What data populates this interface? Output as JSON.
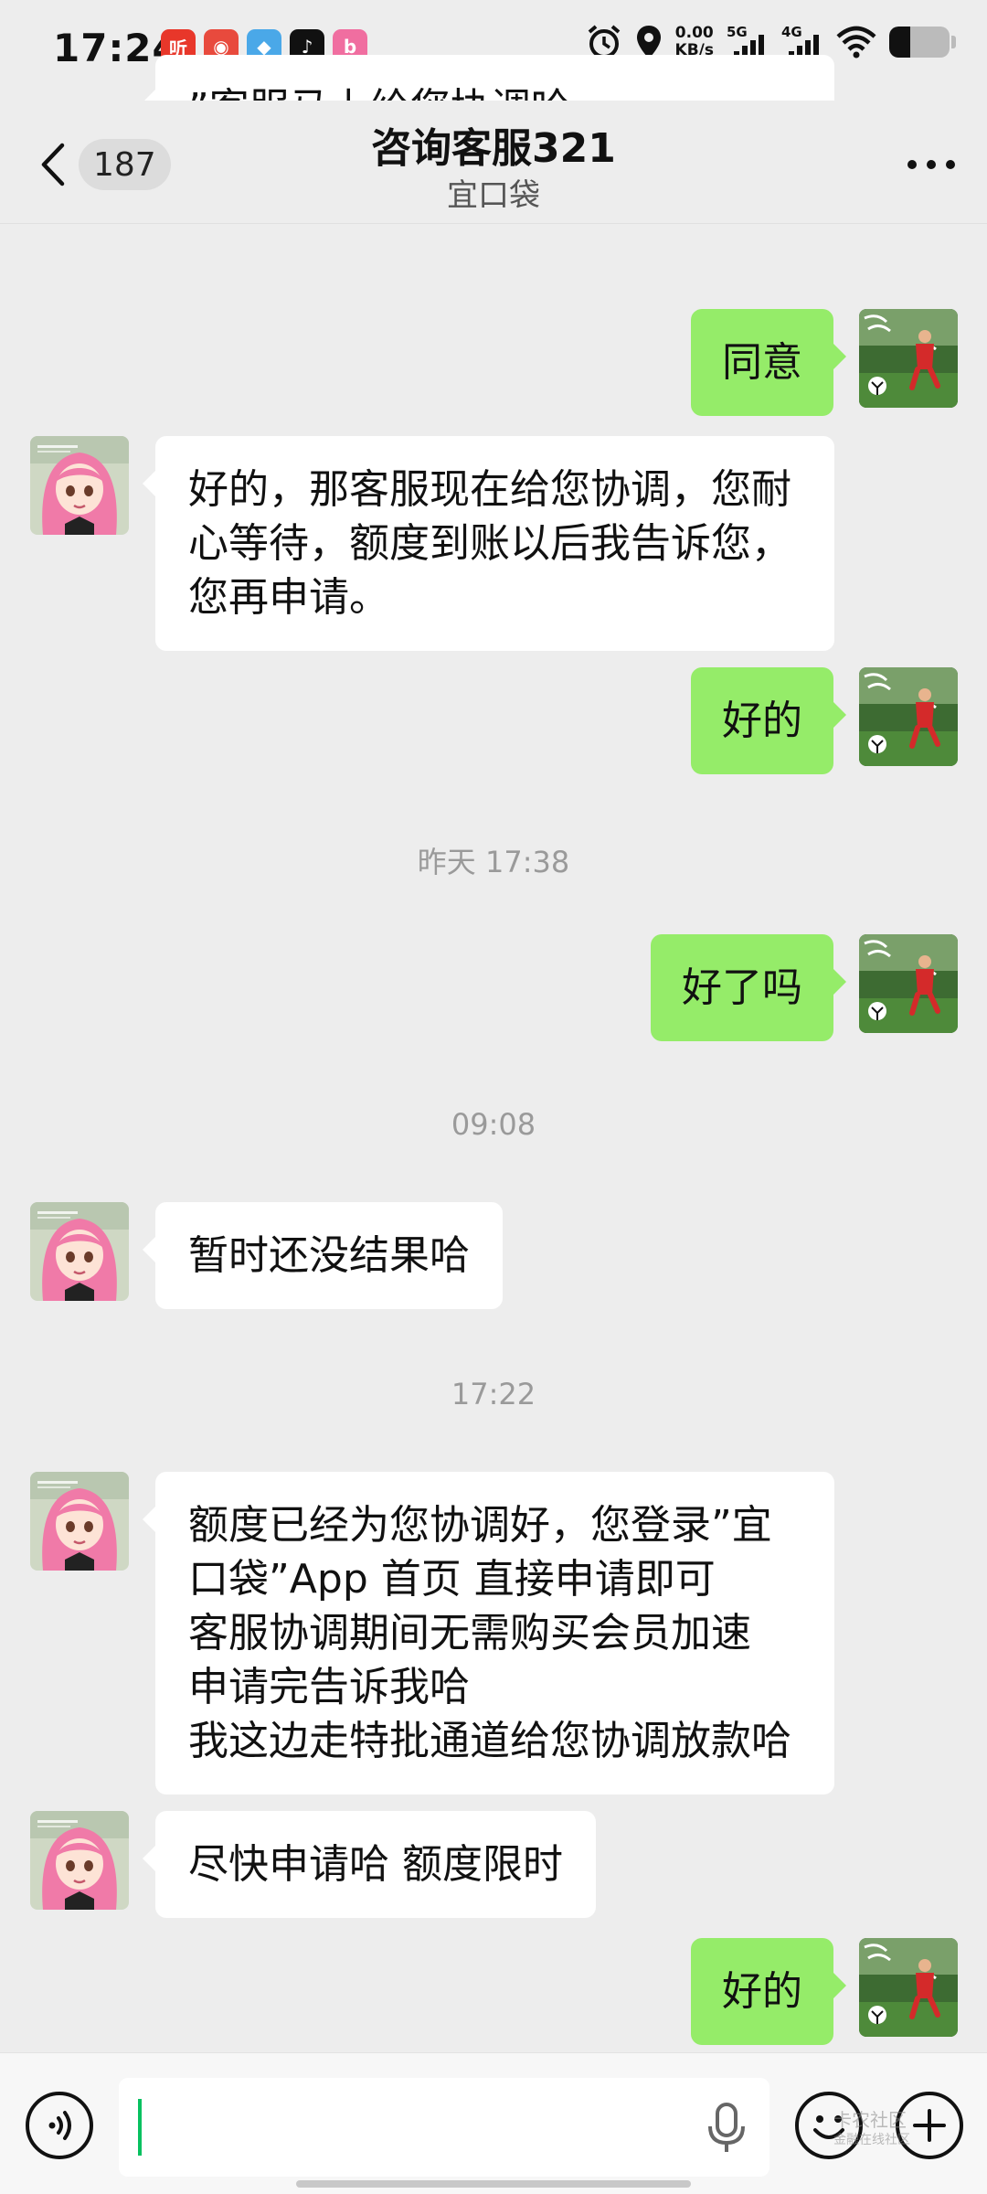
{
  "status_bar": {
    "time": "17:24",
    "app_icons": [
      {
        "name": "ting-app-icon",
        "glyph": "听",
        "color": "#e8372a"
      },
      {
        "name": "news-app-icon",
        "glyph": "◉",
        "color": "#e84a3d"
      },
      {
        "name": "cloud-app-icon",
        "glyph": "◆",
        "color": "#4aa8e8"
      },
      {
        "name": "douyin-app-icon",
        "glyph": "♪",
        "color": "#111111"
      },
      {
        "name": "bilibili-app-icon",
        "glyph": "b",
        "color": "#f06ea0"
      }
    ],
    "net_speed_value": "0.00",
    "net_speed_unit": "KB/s",
    "signal1_label": "5G",
    "signal2_label": "4G",
    "battery_level": 0.35
  },
  "header": {
    "unread_count": "187",
    "title": "咨询客服321",
    "subtitle": "宜口袋"
  },
  "messages": [
    {
      "side": "in",
      "lines": [
        "”客服马上给您协调哈"
      ],
      "partial": true
    },
    {
      "side": "out",
      "lines": [
        "同意"
      ]
    },
    {
      "side": "in",
      "lines": [
        "好的，那客服现在给您协调，您耐",
        "心等待，额度到账以后我告诉您，",
        "您再申请。"
      ]
    },
    {
      "side": "out",
      "lines": [
        "好的"
      ]
    },
    {
      "type": "time",
      "text": "昨天 17:38"
    },
    {
      "side": "out",
      "lines": [
        "好了吗"
      ]
    },
    {
      "type": "time",
      "text": "09:08"
    },
    {
      "side": "in",
      "lines": [
        "暂时还没结果哈"
      ]
    },
    {
      "type": "time",
      "text": "17:22"
    },
    {
      "side": "in",
      "lines": [
        "额度已经为您协调好，您登录”宜",
        "口袋”App 首页  直接申请即可",
        "客服协调期间无需购买会员加速",
        "申请完告诉我哈",
        "我这边走特批通道给您协调放款哈"
      ]
    },
    {
      "side": "in",
      "lines": [
        "尽快申请哈  额度限时"
      ]
    },
    {
      "side": "out",
      "lines": [
        "好的"
      ]
    }
  ],
  "input": {
    "value": "",
    "placeholder": ""
  },
  "watermark": {
    "line1": "卡农社区",
    "line2": "金融在线社区"
  },
  "colors": {
    "background": "#ededed",
    "out_bubble": "#95ec69",
    "in_bubble": "#ffffff",
    "caret": "#07c160"
  }
}
